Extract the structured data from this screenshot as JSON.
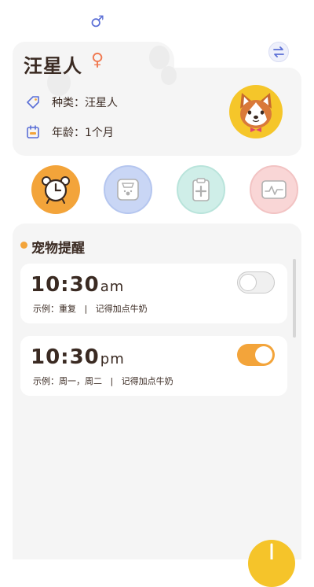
{
  "header": {
    "male_symbol": "♂"
  },
  "profile": {
    "name": "汪星人",
    "gender_symbol": "♀",
    "species_label": "种类：",
    "species_value": "汪星人",
    "age_label": "年龄：",
    "age_value": "1个月"
  },
  "actions": [
    {
      "name": "alarm-clock",
      "color": "#f3a43a"
    },
    {
      "name": "weight-scale",
      "color": "#c9d6f5"
    },
    {
      "name": "medical-record",
      "color": "#cfeee8"
    },
    {
      "name": "health-monitor",
      "color": "#f9d6d6"
    }
  ],
  "reminders": {
    "title": "宠物提醒",
    "items": [
      {
        "time": "10:30",
        "ampm": "am",
        "note": "示例：重复   |   记得加点牛奶",
        "enabled": false
      },
      {
        "time": "10:30",
        "ampm": "pm",
        "note": "示例：周一，周二   |   记得加点牛奶",
        "enabled": true
      }
    ]
  },
  "colors": {
    "accent": "#f3a43a",
    "fab": "#f5c42a",
    "male": "#5b6fd6",
    "female": "#f07a52"
  }
}
